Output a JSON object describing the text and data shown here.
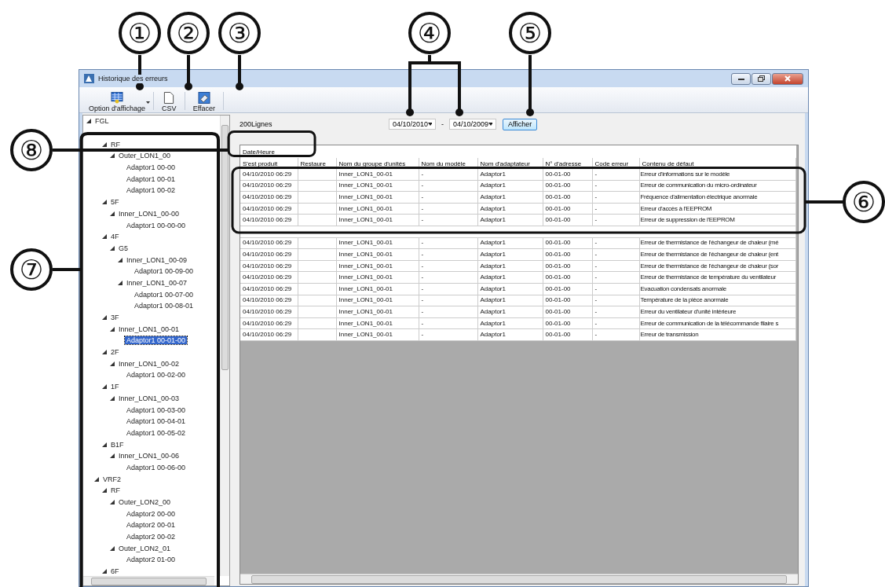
{
  "window": {
    "title": "Historique des erreurs"
  },
  "toolbar": [
    {
      "kind": "grid",
      "label": "Option d'affichage",
      "has_menu": true
    },
    {
      "kind": "document",
      "label": "CSV"
    },
    {
      "kind": "eraser",
      "label": "Effacer"
    }
  ],
  "tree": [
    {
      "label": "FGL",
      "expanded": true,
      "selected": false,
      "children": [
        {
          "children": [
            {
              "label": "RF",
              "expanded": true,
              "selected": false,
              "children": [
                {
                  "label": "Outer_LON1_00",
                  "expanded": true,
                  "selected": false,
                  "children": [
                    {
                      "label": "Adaptor1 00-00",
                      "selected": false
                    },
                    {
                      "label": "Adaptor1 00-01",
                      "selected": false
                    },
                    {
                      "label": "Adaptor1 00-02",
                      "selected": false
                    }
                  ]
                }
              ]
            },
            {
              "label": "5F",
              "expanded": true,
              "selected": false,
              "children": [
                {
                  "label": "Inner_LON1_00-00",
                  "expanded": true,
                  "selected": false,
                  "children": [
                    {
                      "label": "Adaptor1 00-00-00",
                      "selected": false
                    }
                  ]
                }
              ]
            },
            {
              "label": "4F",
              "expanded": true,
              "selected": false,
              "children": [
                {
                  "label": "G5",
                  "expanded": true,
                  "selected": false,
                  "children": [
                    {
                      "label": "Inner_LON1_00-09",
                      "expanded": true,
                      "selected": false,
                      "children": [
                        {
                          "label": "Adaptor1 00-09-00",
                          "selected": false
                        }
                      ]
                    },
                    {
                      "label": "Inner_LON1_00-07",
                      "expanded": true,
                      "selected": false,
                      "children": [
                        {
                          "label": "Adaptor1 00-07-00",
                          "selected": false
                        },
                        {
                          "label": "Adaptor1 00-08-01",
                          "selected": false
                        }
                      ]
                    }
                  ]
                }
              ]
            },
            {
              "label": "3F",
              "expanded": true,
              "selected": false,
              "children": [
                {
                  "label": "Inner_LON1_00-01",
                  "expanded": true,
                  "selected": false,
                  "children": [
                    {
                      "label": "Adaptor1 00-01-00",
                      "selected": true
                    }
                  ]
                }
              ]
            },
            {
              "label": "2F",
              "expanded": true,
              "selected": false,
              "children": [
                {
                  "label": "Inner_LON1_00-02",
                  "expanded": true,
                  "selected": false,
                  "children": [
                    {
                      "label": "Adaptor1 00-02-00",
                      "selected": false
                    }
                  ]
                }
              ]
            },
            {
              "label": "1F",
              "expanded": true,
              "selected": false,
              "children": [
                {
                  "label": "Inner_LON1_00-03",
                  "expanded": true,
                  "selected": false,
                  "children": [
                    {
                      "label": "Adaptor1 00-03-00",
                      "selected": false
                    },
                    {
                      "label": "Adaptor1 00-04-01",
                      "selected": false
                    },
                    {
                      "label": "Adaptor1 00-05-02",
                      "selected": false
                    }
                  ]
                }
              ]
            },
            {
              "label": "B1F",
              "expanded": true,
              "selected": false,
              "children": [
                {
                  "label": "Inner_LON1_00-06",
                  "expanded": true,
                  "selected": false,
                  "children": [
                    {
                      "label": "Adaptor1 00-06-00",
                      "selected": false
                    }
                  ]
                }
              ]
            }
          ]
        },
        {
          "label": "VRF2",
          "expanded": true,
          "selected": false,
          "children": [
            {
              "label": "RF",
              "expanded": true,
              "selected": false,
              "children": [
                {
                  "label": "Outer_LON2_00",
                  "expanded": true,
                  "selected": false,
                  "children": [
                    {
                      "label": "Adaptor2 00-00",
                      "selected": false
                    },
                    {
                      "label": "Adaptor2 00-01",
                      "selected": false
                    },
                    {
                      "label": "Adaptor2 00-02",
                      "selected": false
                    }
                  ]
                },
                {
                  "label": "Outer_LON2_01",
                  "expanded": true,
                  "selected": false,
                  "children": [
                    {
                      "label": "Adaptor2 01-00",
                      "selected": false
                    }
                  ]
                }
              ]
            },
            {
              "label": "6F",
              "expanded": true,
              "selected": false
            }
          ]
        }
      ]
    }
  ],
  "row_count": "200Lignes",
  "date_from": "04/10/2010",
  "date_separator": "-",
  "date_to": "04/10/2009",
  "show_button": "Afficher",
  "table": {
    "group_header": "Date/Heure",
    "columns": [
      "S'est produit",
      "Restaure",
      "Nom du groupe d'unités",
      "Nom du modèle",
      "Nom d'adaptateur",
      "N° d'adresse",
      "Code erreur",
      "Contenu de défaut"
    ],
    "rows": [
      {
        "occurred": "04/10/2010 06:29",
        "group": "Inner_LON1_00-01",
        "model": "-",
        "adapter": "Adaptor1",
        "address": "00-01-00",
        "code": "-",
        "content": "Erreur d'informations sur le modèle"
      },
      {
        "occurred": "04/10/2010 06:29",
        "group": "Inner_LON1_00-01",
        "model": "-",
        "adapter": "Adaptor1",
        "address": "00-01-00",
        "code": "-",
        "content": "Erreur de communication du micro-ordinateur"
      },
      {
        "occurred": "04/10/2010 06:29",
        "group": "Inner_LON1_00-01",
        "model": "-",
        "adapter": "Adaptor1",
        "address": "00-01-00",
        "code": "-",
        "content": "Fréquence d'alimentation électrique anormale"
      },
      {
        "occurred": "04/10/2010 06:29",
        "group": "Inner_LON1_00-01",
        "model": "-",
        "adapter": "Adaptor1",
        "address": "00-01-00",
        "code": "-",
        "content": "Erreur d'accès à l'EEPROM"
      },
      {
        "occurred": "04/10/2010 06:29",
        "group": "Inner_LON1_00-01",
        "model": "-",
        "adapter": "Adaptor1",
        "address": "00-01-00",
        "code": "-",
        "content": "Erreur de suppression de l'EEPROM"
      },
      {
        "occurred": "04/10/2010 06:29",
        "group": "Inner_LON1_00-01",
        "model": "-",
        "adapter": "Adaptor1",
        "address": "00-01-00",
        "code": "-",
        "content": "Erreur de thermistance de l'échangeur de chaleur (mé"
      },
      {
        "occurred": "04/10/2010 06:29",
        "group": "Inner_LON1_00-01",
        "model": "-",
        "adapter": "Adaptor1",
        "address": "00-01-00",
        "code": "-",
        "content": "Erreur de thermistance de l'échangeur de chaleur (ent"
      },
      {
        "occurred": "04/10/2010 06:29",
        "group": "Inner_LON1_00-01",
        "model": "-",
        "adapter": "Adaptor1",
        "address": "00-01-00",
        "code": "-",
        "content": "Erreur de thermistance de l'échangeur de chaleur (sor"
      },
      {
        "occurred": "04/10/2010 06:29",
        "group": "Inner_LON1_00-01",
        "model": "-",
        "adapter": "Adaptor1",
        "address": "00-01-00",
        "code": "-",
        "content": "Erreur de thermistance de température du ventilateur"
      },
      {
        "occurred": "04/10/2010 06:29",
        "group": "Inner_LON1_00-01",
        "model": "-",
        "adapter": "Adaptor1",
        "address": "00-01-00",
        "code": "-",
        "content": "Evacuation condensats anormale"
      },
      {
        "occurred": "04/10/2010 06:29",
        "group": "Inner_LON1_00-01",
        "model": "-",
        "adapter": "Adaptor1",
        "address": "00-01-00",
        "code": "-",
        "content": "Température de la pièce anormale"
      },
      {
        "occurred": "04/10/2010 06:29",
        "group": "Inner_LON1_00-01",
        "model": "-",
        "adapter": "Adaptor1",
        "address": "00-01-00",
        "code": "-",
        "content": "Erreur du ventilateur d'unité intérieure"
      },
      {
        "occurred": "04/10/2010 06:29",
        "group": "Inner_LON1_00-01",
        "model": "-",
        "adapter": "Adaptor1",
        "address": "00-01-00",
        "code": "-",
        "content": "Erreur de communication de la télécommande filaire s"
      },
      {
        "occurred": "04/10/2010 06:29",
        "group": "Inner_LON1_00-01",
        "model": "-",
        "adapter": "Adaptor1",
        "address": "00-01-00",
        "code": "-",
        "content": "Erreur de transmission"
      }
    ]
  },
  "callouts": [
    {
      "label": "①"
    },
    {
      "label": "②"
    },
    {
      "label": "③"
    },
    {
      "label": "④"
    },
    {
      "label": "⑤"
    },
    {
      "label": "⑥"
    },
    {
      "label": "⑦"
    },
    {
      "label": "⑧"
    }
  ]
}
